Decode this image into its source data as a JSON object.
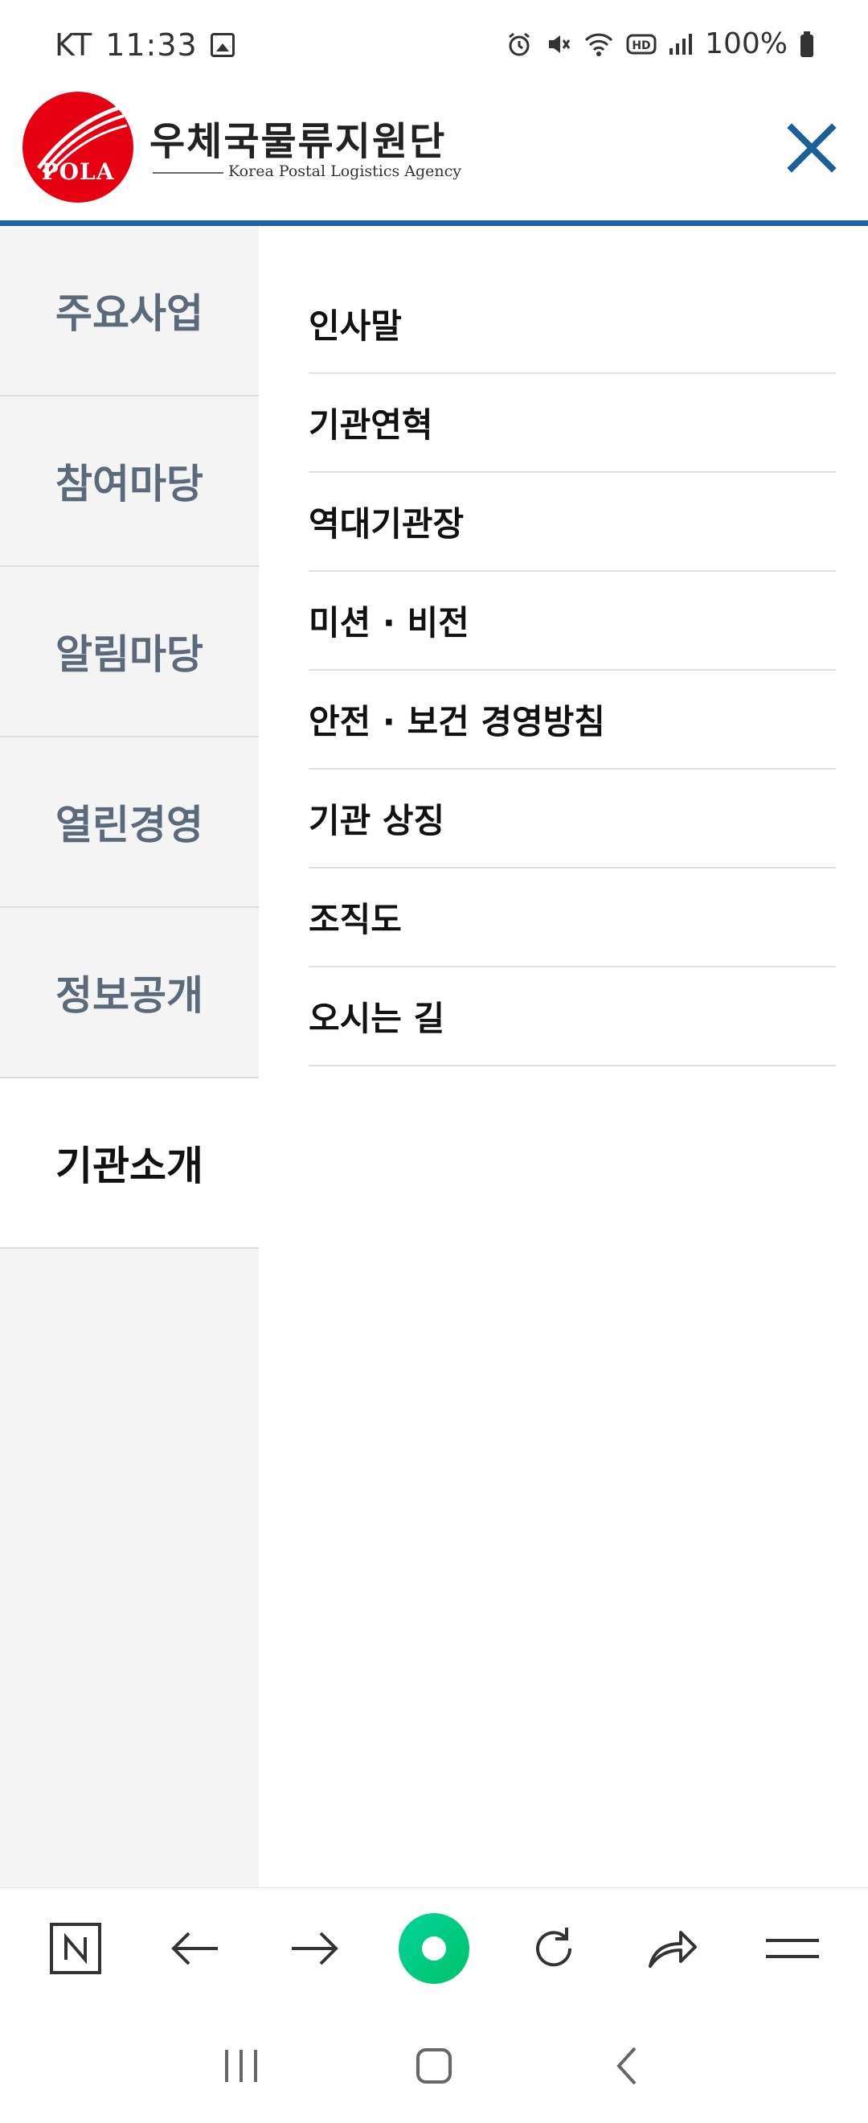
{
  "status_bar": {
    "carrier": "KT",
    "time": "11:33",
    "battery": "100%",
    "icons": [
      "image-icon",
      "alarm-icon",
      "mute-icon",
      "wifi-icon",
      "hd-icon",
      "signal-icon",
      "battery-icon"
    ]
  },
  "header": {
    "logo_text": "POLA",
    "org_name": "우체국물류지원단",
    "org_name_en": "Korea Postal Logistics Agency",
    "close_icon": "close-icon"
  },
  "colors": {
    "brand_red": "#e60012",
    "accent_blue": "#1c63ad",
    "side_bg": "#f4f4f4",
    "side_text": "#5a6a7a",
    "home_green": "#00c98a"
  },
  "side_nav": {
    "items": [
      {
        "label": "주요사업",
        "active": false
      },
      {
        "label": "참여마당",
        "active": false
      },
      {
        "label": "알림마당",
        "active": false
      },
      {
        "label": "열린경영",
        "active": false
      },
      {
        "label": "정보공개",
        "active": false
      },
      {
        "label": "기관소개",
        "active": true
      }
    ]
  },
  "sub_menu": {
    "items": [
      {
        "label": "인사말"
      },
      {
        "label": "기관연혁"
      },
      {
        "label": "역대기관장"
      },
      {
        "label": "미션 · 비전"
      },
      {
        "label": "안전 · 보건 경영방침"
      },
      {
        "label": "기관 상징"
      },
      {
        "label": "조직도"
      },
      {
        "label": "오시는 길"
      }
    ]
  },
  "browser_toolbar": {
    "buttons": [
      "naver-icon",
      "back-arrow-icon",
      "forward-arrow-icon",
      "home-green-icon",
      "refresh-icon",
      "share-icon",
      "menu-icon"
    ]
  },
  "system_nav": {
    "buttons": [
      "recent-apps-icon",
      "home-icon",
      "back-icon"
    ]
  }
}
